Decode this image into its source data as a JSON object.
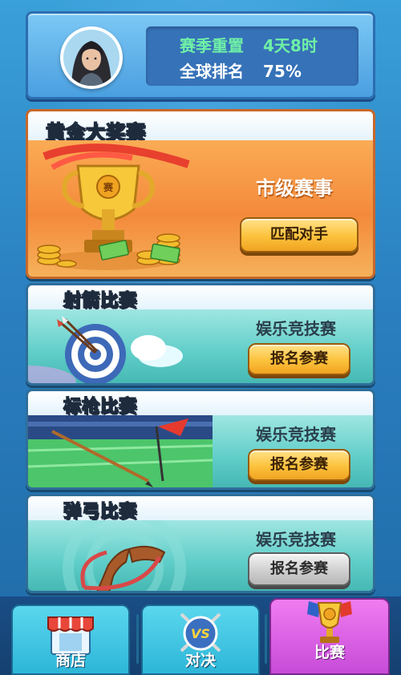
{
  "header": {
    "season_reset_label": "赛季重置",
    "season_reset_value": "4天8时",
    "global_rank_label": "全球排名",
    "global_rank_value": "75%"
  },
  "cards": [
    {
      "title": "黄金大奖赛",
      "event": "市级赛事",
      "button": "匹配对手"
    },
    {
      "title": "射箭比赛",
      "event": "娱乐竞技赛",
      "button": "报名参赛"
    },
    {
      "title": "标枪比赛",
      "event": "娱乐竞技赛",
      "button": "报名参赛"
    },
    {
      "title": "弹弓比赛",
      "event": "娱乐竞技赛",
      "button": "报名参赛"
    }
  ],
  "nav": {
    "shop": "商店",
    "battle": "对决",
    "vs_badge": "VS",
    "contest": "比赛"
  }
}
